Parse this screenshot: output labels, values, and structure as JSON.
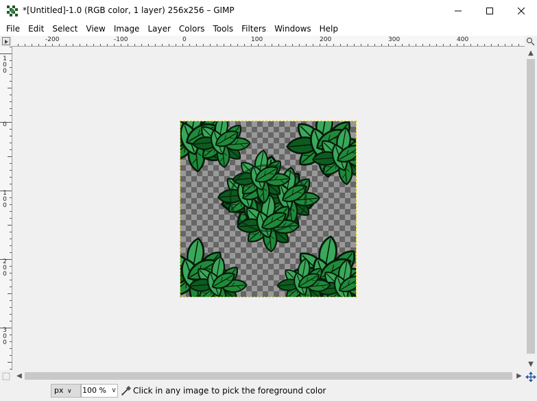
{
  "window": {
    "title": "*[Untitled]-1.0 (RGB color, 1 layer) 256x256 – GIMP",
    "controls": [
      "minimize",
      "maximize",
      "close"
    ]
  },
  "menu": {
    "items": [
      "File",
      "Edit",
      "Select",
      "View",
      "Image",
      "Layer",
      "Colors",
      "Tools",
      "Filters",
      "Windows",
      "Help"
    ]
  },
  "rulers": {
    "horizontal_labels": [
      "-200",
      "-100",
      "0",
      "100",
      "200",
      "300",
      "400"
    ],
    "vertical_labels": [
      "100",
      "0",
      "100",
      "200",
      "300"
    ]
  },
  "canvas": {
    "image_width": 256,
    "image_height": 256,
    "content": "seamless leaf tile over transparency checkerboard"
  },
  "status": {
    "unit": "px",
    "zoom": "100 %",
    "message": "Click in any image to pick the foreground color"
  },
  "colors": {
    "leaf_dark": "#0d5c1f",
    "leaf_mid": "#1f8a3a",
    "leaf_light": "#3aa85a",
    "selection": "#d8c800",
    "checker_dark": "#666666",
    "checker_light": "#999999"
  }
}
